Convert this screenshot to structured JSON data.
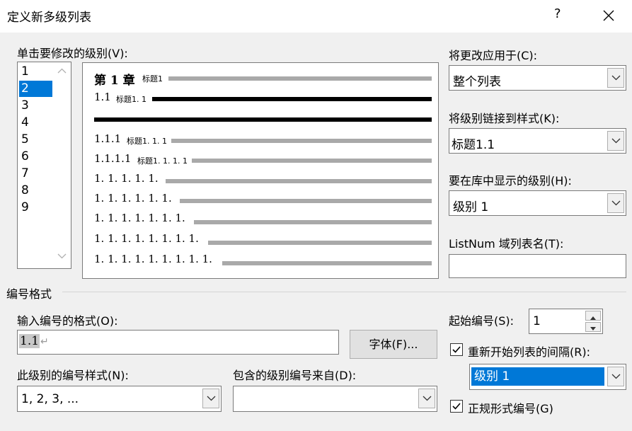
{
  "window": {
    "title": "定义新多级列表",
    "help_label": "?"
  },
  "level_picker": {
    "label": "单击要修改的级别(V):",
    "levels": [
      "1",
      "2",
      "3",
      "4",
      "5",
      "6",
      "7",
      "8",
      "9"
    ],
    "selected_index": 1
  },
  "preview": {
    "rows": [
      {
        "prefix": "第 1 章",
        "text": "标题1"
      },
      {
        "prefix": "1.1",
        "text": "标题1. 1"
      },
      {
        "prefix": "",
        "text": ""
      },
      {
        "prefix": "1.1.1",
        "text": "标题1. 1. 1"
      },
      {
        "prefix": "1.1.1.1",
        "text": "标题1. 1. 1. 1"
      },
      {
        "prefix": "1. 1. 1. 1. 1.",
        "text": ""
      },
      {
        "prefix": "1. 1. 1. 1. 1. 1.",
        "text": ""
      },
      {
        "prefix": "1. 1. 1. 1. 1. 1. 1.",
        "text": ""
      },
      {
        "prefix": "1. 1. 1. 1. 1. 1. 1. 1.",
        "text": ""
      },
      {
        "prefix": "1. 1. 1. 1. 1. 1. 1. 1. 1.",
        "text": ""
      }
    ]
  },
  "right_panel": {
    "apply_to_label": "将更改应用于(C):",
    "apply_to_value": "整个列表",
    "link_style_label": "将级别链接到样式(K):",
    "link_style_value": "标题1.1",
    "gallery_level_label": "要在库中显示的级别(H):",
    "gallery_level_value": "级别 1",
    "listnum_label": "ListNum 域列表名(T):",
    "listnum_value": ""
  },
  "number_format": {
    "section_label": "编号格式",
    "enter_format_label": "输入编号的格式(O):",
    "format_value": "1.1",
    "paragraph_mark": "↵",
    "font_button": "字体(F)...",
    "style_label": "此级别的编号样式(N):",
    "style_value": "1, 2, 3, ...",
    "include_from_label": "包含的级别编号来自(D):",
    "include_from_value": "",
    "start_at_label": "起始编号(S):",
    "start_at_value": "1",
    "restart_label": "重新开始列表的间隔(R):",
    "restart_checked": true,
    "restart_value": "级别 1",
    "legal_label": "正规形式编号(G)",
    "legal_checked": true
  }
}
